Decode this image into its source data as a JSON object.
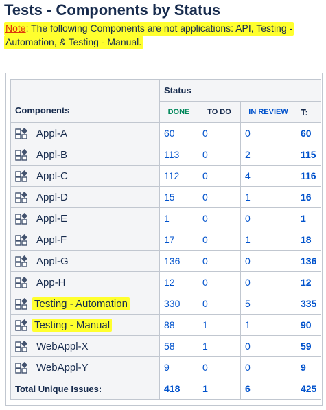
{
  "title": "Tests - Components by Status",
  "note": {
    "label": "Note",
    "line1_text": ": The following Components are not applications: API, Testing -",
    "line2_text": "Automation, & Testing - Manual."
  },
  "table": {
    "components_header": "Components",
    "status_header": "Status",
    "columns": {
      "done": "DONE",
      "todo": "TO DO",
      "in_review": "IN REVIEW",
      "total": "T:"
    },
    "rows": [
      {
        "name": "Appl-A",
        "done": "60",
        "todo": "0",
        "in_review": "0",
        "total": "60"
      },
      {
        "name": "Appl-B",
        "done": "113",
        "todo": "0",
        "in_review": "2",
        "total": "115"
      },
      {
        "name": "Appl-C",
        "done": "112",
        "todo": "0",
        "in_review": "4",
        "total": "116"
      },
      {
        "name": "Appl-D",
        "done": "15",
        "todo": "0",
        "in_review": "1",
        "total": "16"
      },
      {
        "name": "Appl-E",
        "done": "1",
        "todo": "0",
        "in_review": "0",
        "total": "1"
      },
      {
        "name": "Appl-F",
        "done": "17",
        "todo": "0",
        "in_review": "1",
        "total": "18"
      },
      {
        "name": "Appl-G",
        "done": "136",
        "todo": "0",
        "in_review": "0",
        "total": "136"
      },
      {
        "name": "App-H",
        "done": "12",
        "todo": "0",
        "in_review": "0",
        "total": "12"
      },
      {
        "name": "Testing - Automation",
        "done": "330",
        "todo": "0",
        "in_review": "5",
        "total": "335",
        "highlighted": true
      },
      {
        "name": "Testing - Manual",
        "done": "88",
        "todo": "1",
        "in_review": "1",
        "total": "90",
        "highlighted": true
      },
      {
        "name": "WebAppl-X",
        "done": "58",
        "todo": "1",
        "in_review": "0",
        "total": "59"
      },
      {
        "name": "WebAppl-Y",
        "done": "9",
        "todo": "0",
        "in_review": "0",
        "total": "9"
      }
    ],
    "totals": {
      "label": "Total Unique Issues:",
      "done": "418",
      "todo": "1",
      "in_review": "6",
      "total": "425"
    }
  },
  "colors": {
    "highlight": "#ffff2e",
    "link": "#0052cc",
    "done": "#00875a",
    "note": "#de350b",
    "text": "#172b4d"
  },
  "icons": {
    "component": "component-icon"
  }
}
